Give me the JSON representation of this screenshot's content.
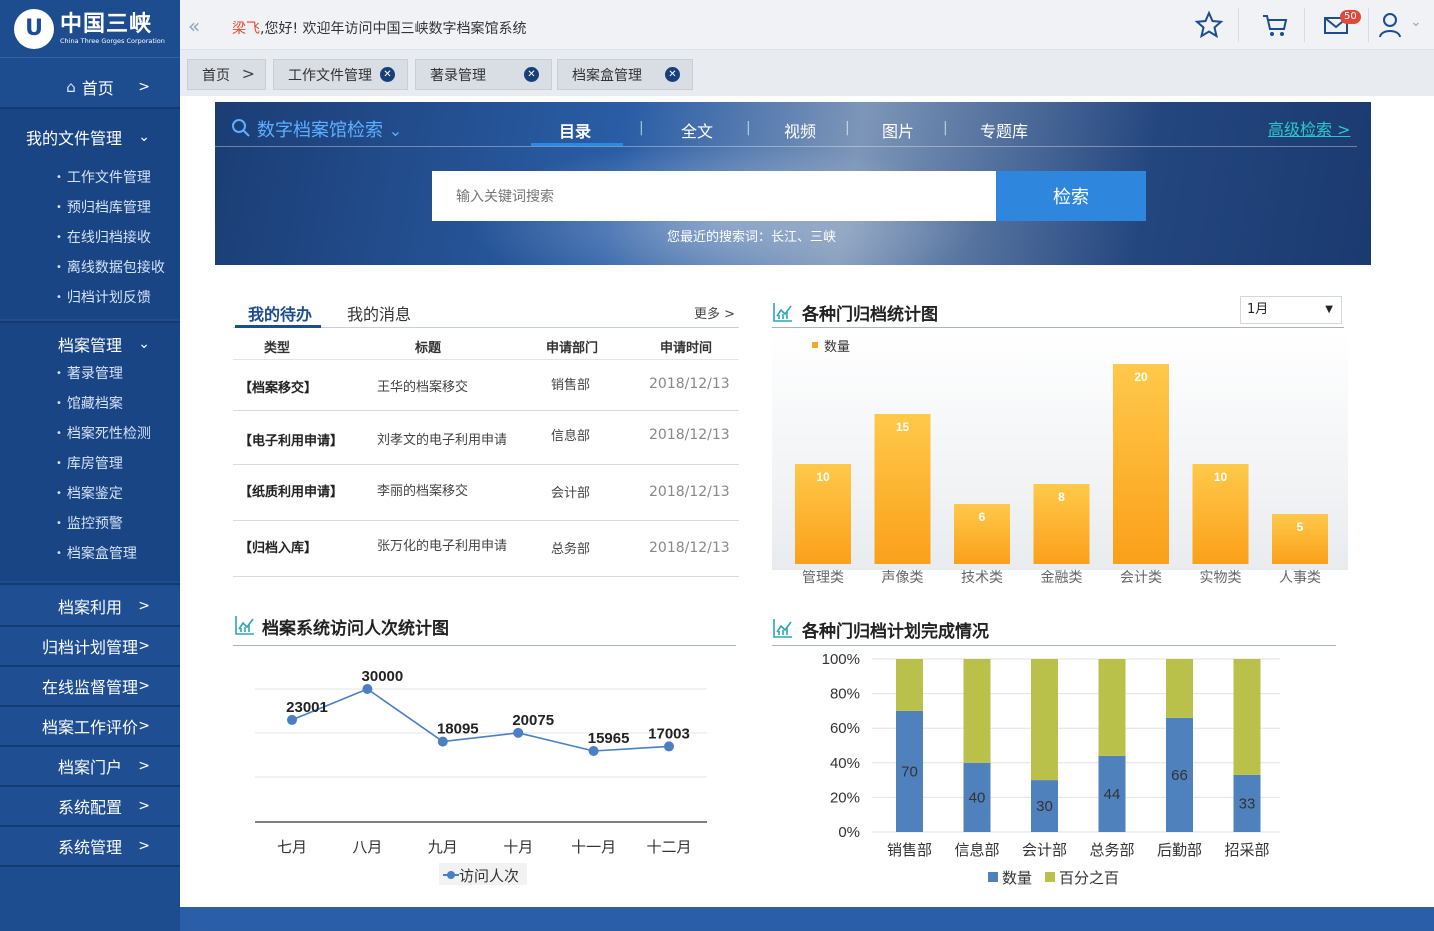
{
  "app": {
    "logo_cn": "中国三峡",
    "logo_en": "China Three Gorges Corporation",
    "logo_mark": "U"
  },
  "sidebar": {
    "home": "首页",
    "my_files": "我的文件管理",
    "my_files_items": [
      "工作文件管理",
      "预归档库管理",
      "在线归档接收",
      "离线数据包接收",
      "归档计划反馈"
    ],
    "archive_mgmt": "档案管理",
    "archive_items": [
      "著录管理",
      "馆藏档案",
      "档案死性检测",
      "库房管理",
      "档案鉴定",
      "监控预警",
      "档案盒管理"
    ],
    "bottom_items": [
      "档案利用",
      "归档计划管理",
      "在线监督管理",
      "档案工作评价",
      "档案门户",
      "系统配置",
      "系统管理"
    ]
  },
  "header": {
    "user": "梁飞",
    "welcome": ",您好! 欢迎年访问中国三峡数字档案馆系统",
    "mail_badge": "50",
    "icons": [
      "star-icon",
      "cart-icon",
      "mail-icon",
      "user-icon"
    ]
  },
  "tabs": [
    {
      "label": "首页",
      "closable": false
    },
    {
      "label": "工作文件管理",
      "closable": true
    },
    {
      "label": "著录管理",
      "closable": true
    },
    {
      "label": "档案盒管理",
      "closable": true
    }
  ],
  "search": {
    "title": "数字档案馆检索",
    "tabs": [
      "目录",
      "全文",
      "视频",
      "图片",
      "专题库"
    ],
    "active_tab": "目录",
    "advanced": "高级检索 >",
    "placeholder": "输入关键词搜索",
    "button": "检索",
    "recent": "您最近的搜索词：长江、三峡"
  },
  "todo": {
    "tabs": [
      "我的待办",
      "我的消息"
    ],
    "more": "更多 >",
    "columns": [
      "类型",
      "标题",
      "申请部门",
      "申请时间"
    ],
    "rows": [
      {
        "type": "【档案移交】",
        "title": "王华的档案移交",
        "dept": "销售部",
        "date": "2018/12/13"
      },
      {
        "type": "【电子利用申请】",
        "title": "刘孝文的电子利用申请",
        "dept": "信息部",
        "date": "2018/12/13"
      },
      {
        "type": "【纸质利用申请】",
        "title": "李丽的档案移交",
        "dept": "会计部",
        "date": "2018/12/13"
      },
      {
        "type": "【归档入库】",
        "title": "张万化的电子利用申请",
        "dept": "总务部",
        "date": "2018/12/13"
      }
    ]
  },
  "colors": {
    "sidebar": "#1d4d8f",
    "accent": "#2e86dd",
    "bar_orange": "#f9a825",
    "line_blue": "#4a7fc1",
    "stack_blue": "#4f81bd",
    "stack_olive": "#b9c14a"
  },
  "chart_data": [
    {
      "type": "bar",
      "title": "各种门归档统计图",
      "filter": "1月",
      "legend": [
        "数量"
      ],
      "categories": [
        "管理类",
        "声像类",
        "技术类",
        "金融类",
        "会计类",
        "实物类",
        "人事类"
      ],
      "series": [
        {
          "name": "数量",
          "values": [
            10,
            15,
            6,
            8,
            20,
            10,
            5
          ]
        }
      ],
      "ylim": [
        0,
        20
      ]
    },
    {
      "type": "line",
      "title": "档案系统访问人次统计图",
      "legend": [
        "访问人次"
      ],
      "categories": [
        "七月",
        "八月",
        "九月",
        "十月",
        "十一月",
        "十二月"
      ],
      "series": [
        {
          "name": "访问人次",
          "values": [
            23001,
            30000,
            18095,
            20075,
            15965,
            17003
          ]
        }
      ]
    },
    {
      "type": "bar",
      "stacked": true,
      "title": "各种门归档计划完成情况",
      "categories": [
        "销售部",
        "信息部",
        "会计部",
        "总务部",
        "后勤部",
        "招采部"
      ],
      "series": [
        {
          "name": "数量",
          "values": [
            70,
            40,
            30,
            44,
            66,
            33
          ]
        },
        {
          "name": "百分之百",
          "values": [
            30,
            60,
            70,
            56,
            34,
            67
          ]
        }
      ],
      "yticks": [
        "0%",
        "20%",
        "40%",
        "60%",
        "80%",
        "100%"
      ],
      "ylim": [
        0,
        100
      ]
    }
  ]
}
